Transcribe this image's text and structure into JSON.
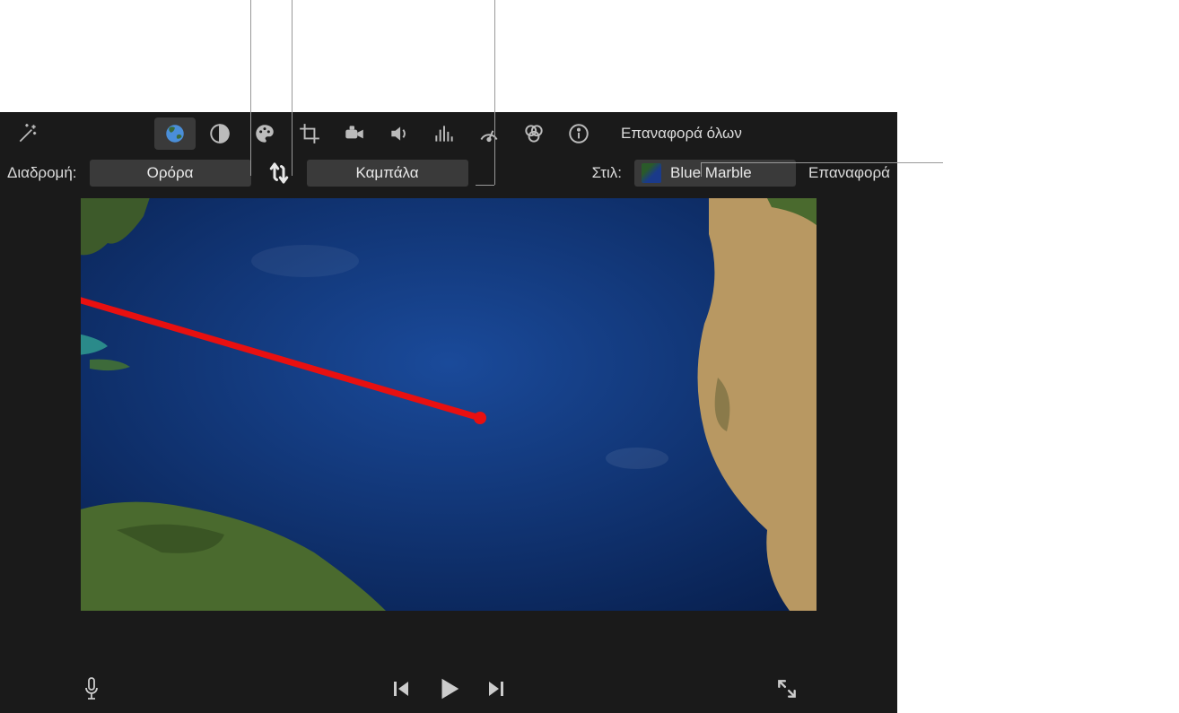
{
  "toolbar": {
    "reset_all_label": "Επαναφορά όλων",
    "icons": {
      "wand": "magic-wand-icon",
      "globe": "globe-icon",
      "contrast": "contrast-icon",
      "palette": "palette-icon",
      "crop": "crop-icon",
      "camera": "video-camera-icon",
      "speaker": "speaker-icon",
      "equalizer": "equalizer-icon",
      "speedometer": "speedometer-icon",
      "filters": "filters-icon",
      "info": "info-icon"
    }
  },
  "route_bar": {
    "route_label": "Διαδρομή:",
    "from_location": "Ορόρα",
    "to_location": "Καμπάλα",
    "style_label": "Στιλ:",
    "style_name": "Blue Marble",
    "reset_label": "Επαναφορά"
  },
  "playbar": {
    "mic": "microphone-icon",
    "prev": "previous-icon",
    "play": "play-icon",
    "next": "next-icon",
    "expand": "expand-icon"
  },
  "colors": {
    "bg": "#1a1a1a",
    "button_bg": "#3a3a3a",
    "text": "#e8e8e8",
    "route_line": "#e20000"
  }
}
